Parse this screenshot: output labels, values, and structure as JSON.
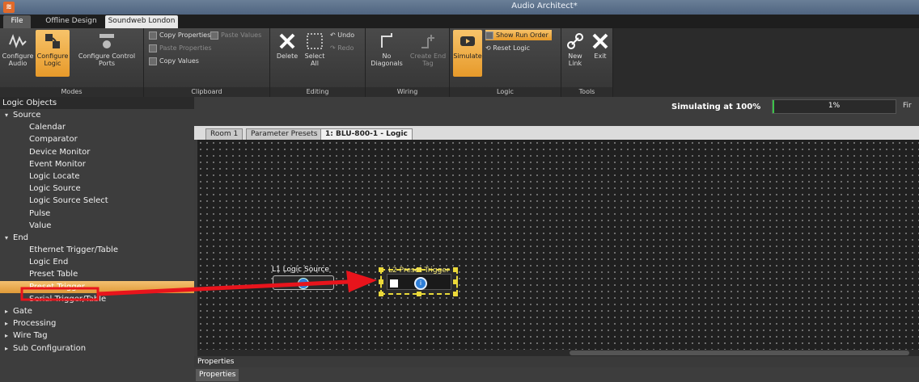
{
  "window": {
    "title": "Audio Architect*"
  },
  "ribbon_tabs": [
    {
      "label": "File"
    },
    {
      "label": "Offline Design"
    },
    {
      "label": "Soundweb London"
    }
  ],
  "ribbon": {
    "modes": {
      "label": "Modes",
      "configure_audio": "Configure Audio",
      "configure_logic": "Configure Logic",
      "configure_control_ports": "Configure Control Ports"
    },
    "clipboard": {
      "label": "Clipboard",
      "copy_properties": "Copy Properties",
      "paste_values": "Paste Values",
      "paste_properties": "Paste Properties",
      "copy_values": "Copy Values"
    },
    "editing": {
      "label": "Editing",
      "delete": "Delete",
      "select_all": "Select All",
      "undo": "Undo",
      "redo": "Redo"
    },
    "wiring": {
      "label": "Wiring",
      "no_diagonals": "No Diagonals",
      "create_end_tag": "Create End Tag"
    },
    "logic": {
      "label": "Logic",
      "simulate": "Simulate",
      "show_run_order": "Show Run Order",
      "reset_logic": "Reset Logic"
    },
    "tools": {
      "label": "Tools",
      "new_link": "New Link",
      "exit": "Exit"
    }
  },
  "left_panel": {
    "title": "Logic Objects",
    "tree": [
      {
        "type": "cat",
        "label": "Source",
        "expanded": true
      },
      {
        "type": "item",
        "label": "Calendar"
      },
      {
        "type": "item",
        "label": "Comparator"
      },
      {
        "type": "item",
        "label": "Device Monitor"
      },
      {
        "type": "item",
        "label": "Event Monitor"
      },
      {
        "type": "item",
        "label": "Logic Locate"
      },
      {
        "type": "item",
        "label": "Logic Source"
      },
      {
        "type": "item",
        "label": "Logic Source Select"
      },
      {
        "type": "item",
        "label": "Pulse"
      },
      {
        "type": "item",
        "label": "Value"
      },
      {
        "type": "cat",
        "label": "End",
        "expanded": true
      },
      {
        "type": "item",
        "label": "Ethernet Trigger/Table"
      },
      {
        "type": "item",
        "label": "Logic End"
      },
      {
        "type": "item",
        "label": "Preset Table"
      },
      {
        "type": "item",
        "label": "Preset Trigger",
        "selected": true
      },
      {
        "type": "item",
        "label": "Serial Trigger/Table"
      },
      {
        "type": "cat",
        "label": "Gate",
        "expanded": false
      },
      {
        "type": "cat",
        "label": "Processing",
        "expanded": false
      },
      {
        "type": "cat",
        "label": "Wire Tag",
        "expanded": false
      },
      {
        "type": "cat",
        "label": "Sub Configuration",
        "expanded": false
      }
    ]
  },
  "status": {
    "simulating": "Simulating at 100%",
    "progress_text": "1%",
    "progress_value": 0.01,
    "finish_label": "Fir"
  },
  "doc_tabs": [
    {
      "label": "Room 1"
    },
    {
      "label": "Parameter Presets"
    },
    {
      "label": "1: BLU-800-1 - Logic",
      "active": true
    }
  ],
  "canvas": {
    "blocks": [
      {
        "label": "L1  Logic Source"
      },
      {
        "label": "L2  Preset Trigger"
      }
    ]
  },
  "properties": {
    "header": "Properties",
    "tab": "Properties"
  },
  "colors": {
    "accent": "#e79a2a",
    "annotation_red": "#e8141c",
    "selection_yellow": "#e8d93a",
    "block_blue": "#2f7fd8"
  }
}
